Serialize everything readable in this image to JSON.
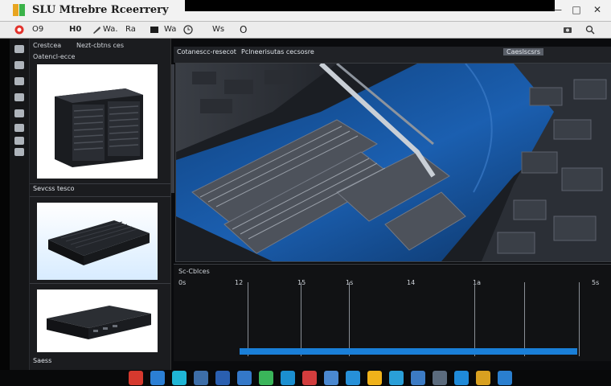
{
  "window": {
    "title": "SLU Mtrebre Rceerrery",
    "controls": [
      "—",
      "□",
      "✕"
    ]
  },
  "toolbar": {
    "items": [
      {
        "label": "O9",
        "icon": "record-icon",
        "color": "#e2322c"
      },
      {
        "label": "H0"
      },
      {
        "label": "Wa.",
        "icon": "wrench-icon"
      },
      {
        "label": "Ra"
      },
      {
        "label": "Wa",
        "icon": "image-icon"
      },
      {
        "label": "Ws",
        "icon": "clock-icon"
      },
      {
        "label": "O",
        "icon": "circle-icon"
      }
    ]
  },
  "sidebar": {
    "icons": [
      "home-icon",
      "settings-icon",
      "folder-icon",
      "tag-icon",
      "user-icon",
      "list-icon",
      "layers-icon",
      "info-icon"
    ]
  },
  "thumbs": {
    "header1": "Crestcea",
    "header2": "Nezt-cbtns ces",
    "header3": "Oatencl-ecce",
    "items": [
      {
        "caption": "Sevcss tesco",
        "icon": "device-icon"
      },
      {
        "caption": ""
      },
      {
        "caption": "Saess"
      }
    ]
  },
  "main": {
    "tab": "Pclneerisutas cecsosre",
    "sub": "Cotanescc-resecot",
    "right_tab": "Caeslscsrs"
  },
  "timeline": {
    "label": "Sc-Cblces",
    "ticks": [
      "0s",
      "12",
      "15",
      "1s",
      "14",
      "1a",
      "5s"
    ]
  },
  "taskbar": {
    "apps": [
      {
        "icon": "app-red-icon",
        "color": "#d6392e"
      },
      {
        "icon": "app-blue-icon",
        "color": "#2b7fd4"
      },
      {
        "icon": "app-cyan-icon",
        "color": "#1fb6d6"
      },
      {
        "icon": "app-people-icon",
        "color": "#3d6ea8"
      },
      {
        "icon": "app-screen-icon",
        "color": "#2a5fb0"
      },
      {
        "icon": "app-doc-icon",
        "color": "#3478c8"
      },
      {
        "icon": "app-chat-icon",
        "color": "#3ab55a"
      },
      {
        "icon": "app-store-icon",
        "color": "#1b8fd0"
      },
      {
        "icon": "app-pin-icon",
        "color": "#d23d3d"
      },
      {
        "icon": "app-mail-icon",
        "color": "#4a88d0"
      },
      {
        "icon": "app-video-icon",
        "color": "#2690d8"
      },
      {
        "icon": "app-sun-icon",
        "color": "#f0b21a"
      },
      {
        "icon": "app-map-icon",
        "color": "#2a9fd8"
      },
      {
        "icon": "app-shield-icon",
        "color": "#3c7bc4"
      },
      {
        "icon": "app-web-icon",
        "color": "#5b6b7d"
      },
      {
        "icon": "app-edge-icon",
        "color": "#1f8ad8"
      },
      {
        "icon": "app-stack-icon",
        "color": "#d8a020"
      },
      {
        "icon": "app-grid-icon",
        "color": "#2a7fcf"
      }
    ]
  }
}
